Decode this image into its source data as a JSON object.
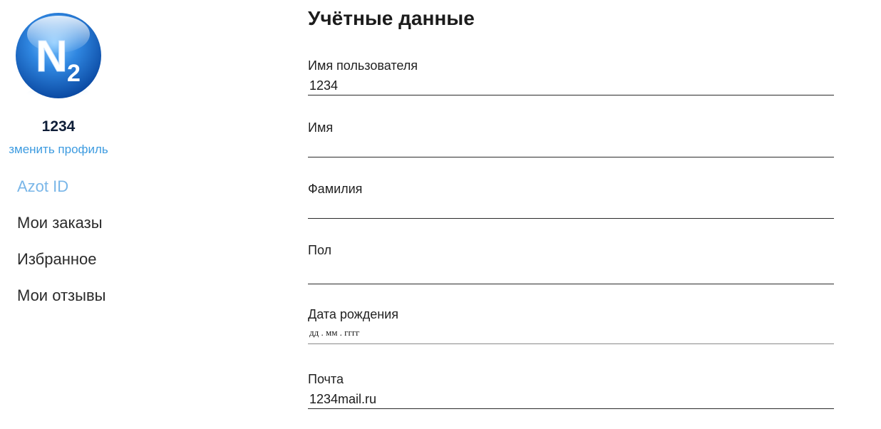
{
  "sidebar": {
    "avatar_icon": "n2-logo-icon",
    "username": "1234",
    "edit_profile": "зменить профиль",
    "nav": [
      {
        "label": "Azot ID",
        "active": true
      },
      {
        "label": "Мои заказы",
        "active": false
      },
      {
        "label": "Избранное",
        "active": false
      },
      {
        "label": "Мои отзывы",
        "active": false
      }
    ]
  },
  "main": {
    "title": "Учётные данные",
    "fields": {
      "username": {
        "label": "Имя пользователя",
        "value": "1234"
      },
      "first_name": {
        "label": "Имя",
        "value": ""
      },
      "last_name": {
        "label": "Фамилия",
        "value": ""
      },
      "gender": {
        "label": "Пол",
        "value": ""
      },
      "birthdate": {
        "label": "Дата рождения",
        "placeholder": "дд . мм . гггг"
      },
      "email": {
        "label": "Почта",
        "value": "1234mail.ru"
      }
    }
  },
  "colors": {
    "accent": "#3d9be0",
    "active_nav": "#79b6e8",
    "text": "#1a1a1a",
    "divider": "#2b2b2b"
  }
}
